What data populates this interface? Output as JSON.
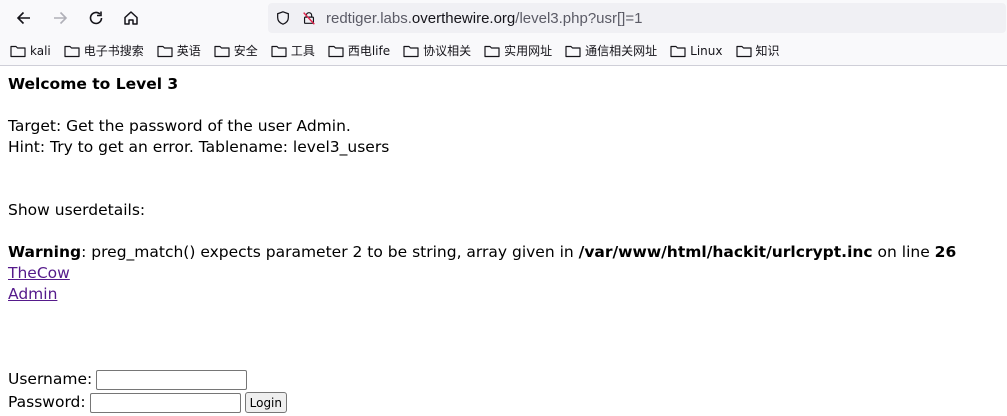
{
  "browser": {
    "url_prefix": "redtiger.labs.",
    "url_domain": "overthewire.org",
    "url_suffix": "/level3.php?usr[]=1"
  },
  "bookmarks": [
    {
      "label": "kali"
    },
    {
      "label": "电子书搜索"
    },
    {
      "label": "英语"
    },
    {
      "label": "安全"
    },
    {
      "label": "工具"
    },
    {
      "label": "西电life"
    },
    {
      "label": "协议相关"
    },
    {
      "label": "实用网址"
    },
    {
      "label": "通信相关网址"
    },
    {
      "label": "Linux"
    },
    {
      "label": "知识"
    }
  ],
  "page": {
    "heading": "Welcome to Level 3",
    "target": "Target: Get the password of the user Admin.",
    "hint": "Hint: Try to get an error. Tablename: level3_users",
    "show_userdetails": "Show userdetails:",
    "warning": {
      "label": "Warning",
      "message": ": preg_match() expects parameter 2 to be string, array given in ",
      "file": "/var/www/html/hackit/urlcrypt.inc",
      "online": " on line ",
      "line": "26"
    },
    "users": [
      "TheCow",
      "Admin"
    ],
    "form": {
      "username_label": "Username:",
      "password_label": "Password:",
      "login_label": "Login"
    }
  }
}
